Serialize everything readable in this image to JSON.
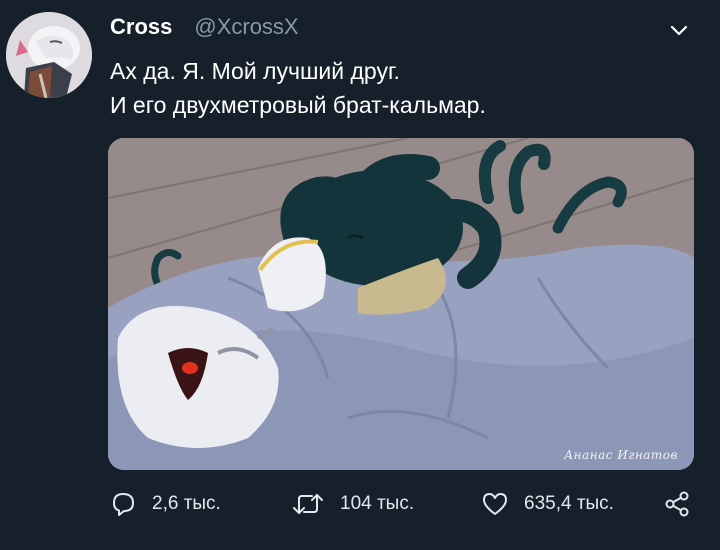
{
  "user": {
    "display_name": "Cross",
    "handle": "@XcrossX",
    "avatar_icon": "avatar-image"
  },
  "tweet": {
    "lines": [
      "Ах да. Я. Мой лучший друг.",
      "И его двухметровый брат-кальмар."
    ],
    "menu_icon": "chevron-down-icon"
  },
  "media": {
    "signature": "Ананас Игнатов"
  },
  "actions": {
    "reply_count": "2,6 тыс.",
    "retweet_count": "104 тыс.",
    "like_count": "635,4 тыс.",
    "reply_icon": "reply-icon",
    "retweet_icon": "retweet-icon",
    "like_icon": "heart-icon",
    "share_icon": "share-icon"
  },
  "colors": {
    "background": "#15202b",
    "secondary_text": "#8899a6",
    "blanket": "#9aa3c0",
    "tentacle": "#163b40"
  }
}
